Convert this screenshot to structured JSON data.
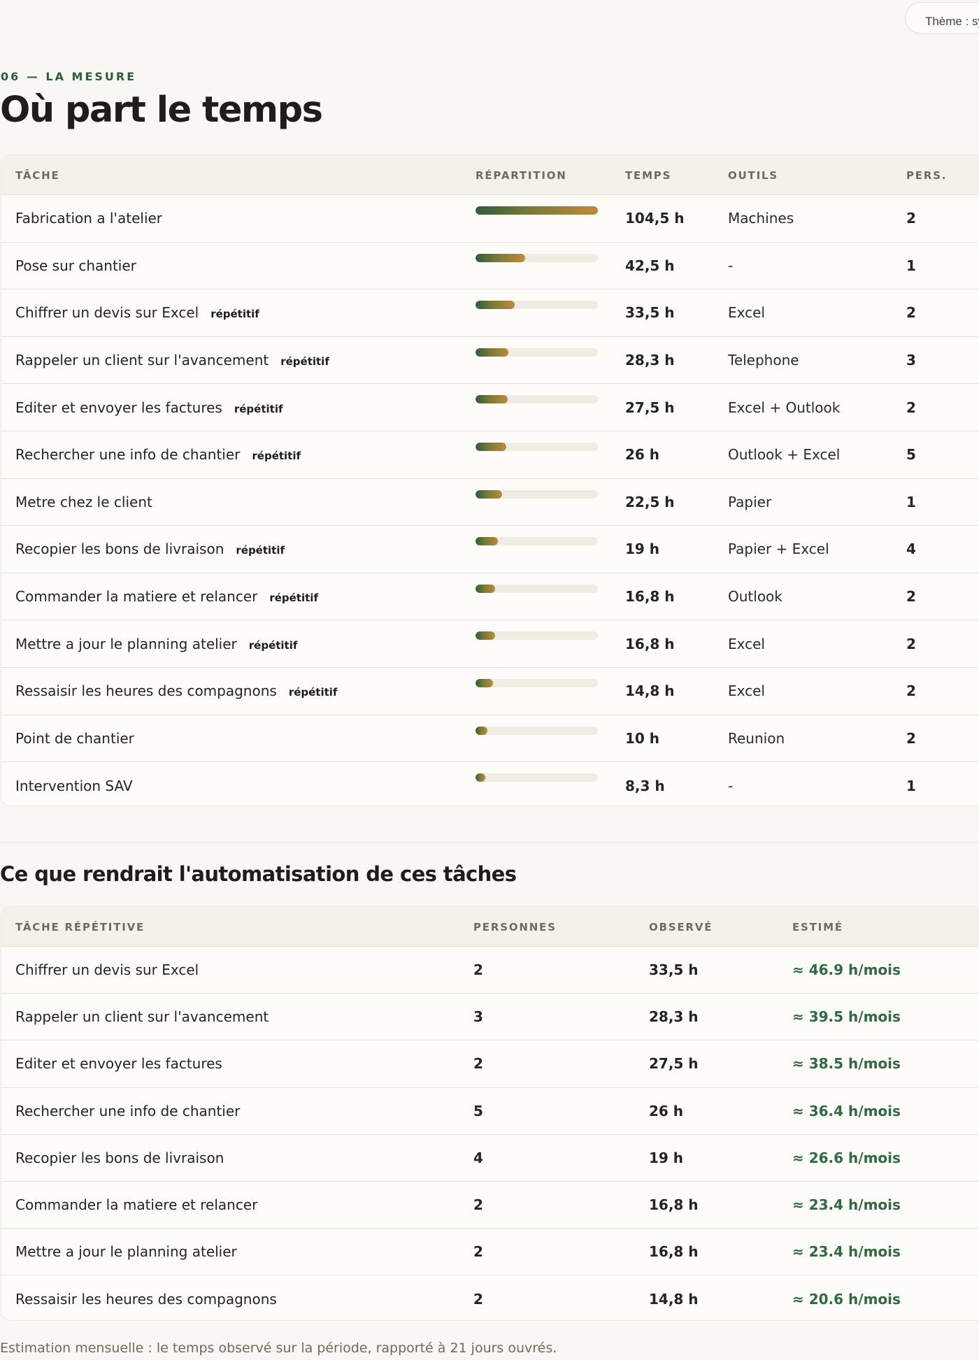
{
  "theme": {
    "label": "Thème : sy"
  },
  "header": {
    "eyebrow": "06 — LA MESURE",
    "title": "Où part le temps"
  },
  "time_table": {
    "headers": {
      "task": "TÂCHE",
      "distribution": "RÉPARTITION",
      "time": "TEMPS",
      "tools": "OUTILS",
      "people": "PERS."
    },
    "rows": [
      {
        "task": "Fabrication a l'atelier",
        "tag": "",
        "fill_percent": 100,
        "time": "104,5 h",
        "tools": "Machines",
        "people": "2"
      },
      {
        "task": "Pose sur chantier",
        "tag": "",
        "fill_percent": 40.7,
        "time": "42,5 h",
        "tools": "-",
        "people": "1"
      },
      {
        "task": "Chiffrer un devis sur Excel",
        "tag": "répétitif",
        "fill_percent": 32.1,
        "time": "33,5 h",
        "tools": "Excel",
        "people": "2"
      },
      {
        "task": "Rappeler un client sur l'avancement",
        "tag": "répétitif",
        "fill_percent": 27.1,
        "time": "28,3 h",
        "tools": "Telephone",
        "people": "3"
      },
      {
        "task": "Editer et envoyer les factures",
        "tag": "répétitif",
        "fill_percent": 26.3,
        "time": "27,5 h",
        "tools": "Excel + Outlook",
        "people": "2"
      },
      {
        "task": "Rechercher une info de chantier",
        "tag": "répétitif",
        "fill_percent": 24.9,
        "time": "26 h",
        "tools": "Outlook + Excel",
        "people": "5"
      },
      {
        "task": "Metre chez le client",
        "tag": "",
        "fill_percent": 21.5,
        "time": "22,5 h",
        "tools": "Papier",
        "people": "1"
      },
      {
        "task": "Recopier les bons de livraison",
        "tag": "répétitif",
        "fill_percent": 18.2,
        "time": "19 h",
        "tools": "Papier + Excel",
        "people": "4"
      },
      {
        "task": "Commander la matiere et relancer",
        "tag": "répétitif",
        "fill_percent": 16.1,
        "time": "16,8 h",
        "tools": "Outlook",
        "people": "2"
      },
      {
        "task": "Mettre a jour le planning atelier",
        "tag": "répétitif",
        "fill_percent": 16.1,
        "time": "16,8 h",
        "tools": "Excel",
        "people": "2"
      },
      {
        "task": "Ressaisir les heures des compagnons",
        "tag": "répétitif",
        "fill_percent": 14.2,
        "time": "14,8 h",
        "tools": "Excel",
        "people": "2"
      },
      {
        "task": "Point de chantier",
        "tag": "",
        "fill_percent": 9.6,
        "time": "10 h",
        "tools": "Reunion",
        "people": "2"
      },
      {
        "task": "Intervention SAV",
        "tag": "",
        "fill_percent": 7.9,
        "time": "8,3 h",
        "tools": "-",
        "people": "1"
      }
    ]
  },
  "automation": {
    "title": "Ce que rendrait l'automatisation de ces tâches",
    "headers": {
      "task": "TÂCHE RÉPÉTITIVE",
      "people": "PERSONNES",
      "observed": "OBSERVÉ",
      "estimated": "ESTIMÉ"
    },
    "rows": [
      {
        "task": "Chiffrer un devis sur Excel",
        "people": "2",
        "observed": "33,5 h",
        "estimated": "≈ 46.9 h/mois"
      },
      {
        "task": "Rappeler un client sur l'avancement",
        "people": "3",
        "observed": "28,3 h",
        "estimated": "≈ 39.5 h/mois"
      },
      {
        "task": "Editer et envoyer les factures",
        "people": "2",
        "observed": "27,5 h",
        "estimated": "≈ 38.5 h/mois"
      },
      {
        "task": "Rechercher une info de chantier",
        "people": "5",
        "observed": "26 h",
        "estimated": "≈ 36.4 h/mois"
      },
      {
        "task": "Recopier les bons de livraison",
        "people": "4",
        "observed": "19 h",
        "estimated": "≈ 26.6 h/mois"
      },
      {
        "task": "Commander la matiere et relancer",
        "people": "2",
        "observed": "16,8 h",
        "estimated": "≈ 23.4 h/mois"
      },
      {
        "task": "Mettre a jour le planning atelier",
        "people": "2",
        "observed": "16,8 h",
        "estimated": "≈ 23.4 h/mois"
      },
      {
        "task": "Ressaisir les heures des compagnons",
        "people": "2",
        "observed": "14,8 h",
        "estimated": "≈ 20.6 h/mois"
      }
    ],
    "footnote": "Estimation mensuelle : le temps observé sur la période, rapporté à 21 jours ouvrés."
  },
  "colors": {
    "accent": "#2f5d3a",
    "bar_end": "#c08a3a",
    "estimate": "#2f6a40"
  }
}
